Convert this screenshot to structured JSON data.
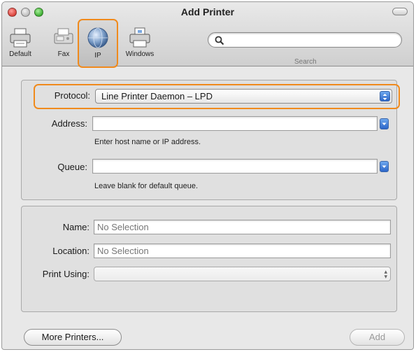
{
  "window": {
    "title": "Add Printer"
  },
  "toolbar": {
    "items": [
      {
        "label": "Default",
        "icon": "printer-icon"
      },
      {
        "label": "Fax",
        "icon": "fax-icon"
      },
      {
        "label": "IP",
        "icon": "globe-icon",
        "selected": true
      },
      {
        "label": "Windows",
        "icon": "windows-printer-icon"
      }
    ],
    "search": {
      "label": "Search",
      "value": ""
    }
  },
  "protocol": {
    "label": "Protocol:",
    "value": "Line Printer Daemon – LPD"
  },
  "address": {
    "label": "Address:",
    "value": "",
    "hint": "Enter host name or IP address."
  },
  "queue": {
    "label": "Queue:",
    "value": "",
    "hint": "Leave blank for default queue."
  },
  "details": {
    "name": {
      "label": "Name:",
      "value": "No Selection"
    },
    "location": {
      "label": "Location:",
      "value": "No Selection"
    },
    "print_using": {
      "label": "Print Using:",
      "value": ""
    }
  },
  "buttons": {
    "more_printers": "More Printers...",
    "add": "Add"
  },
  "colors": {
    "highlight": "#f08a1c",
    "accent": "#2c66c9"
  }
}
